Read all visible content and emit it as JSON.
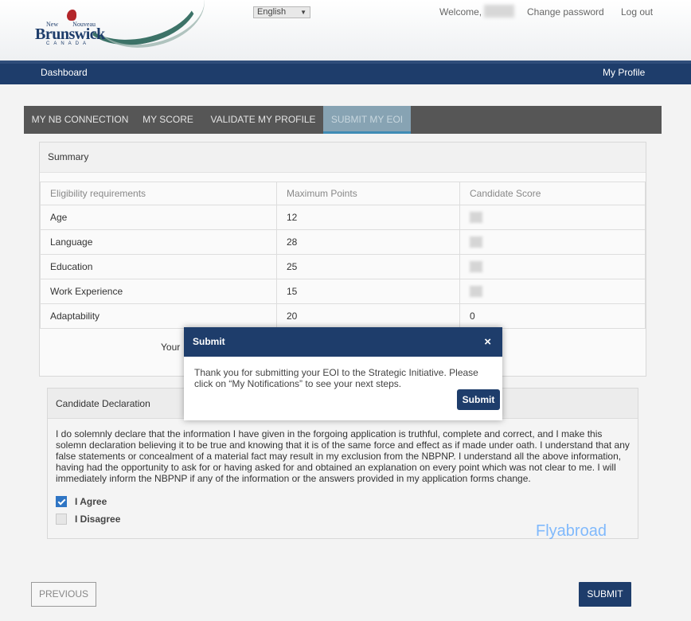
{
  "header": {
    "logo": {
      "top_left": "New",
      "top_right": "Nouveau",
      "brand": "Brunswick",
      "country": "CANADA"
    },
    "language": "English",
    "welcome": "Welcome,",
    "change_password": "Change password",
    "logout": "Log out"
  },
  "nav": {
    "dashboard": "Dashboard",
    "my_profile": "My Profile"
  },
  "tabs": [
    {
      "label": "MY NB CONNECTION",
      "active": false
    },
    {
      "label": "MY SCORE",
      "active": false
    },
    {
      "label": "VALIDATE MY PROFILE",
      "active": false
    },
    {
      "label": "SUBMIT MY EOI",
      "active": true
    }
  ],
  "summary": {
    "title": "Summary",
    "columns": [
      "Eligibility requirements",
      "Maximum Points",
      "Candidate Score"
    ],
    "rows": [
      {
        "requirement": "Age",
        "max": "12",
        "score": ""
      },
      {
        "requirement": "Language",
        "max": "28",
        "score": ""
      },
      {
        "requirement": "Education",
        "max": "25",
        "score": ""
      },
      {
        "requirement": "Work Experience",
        "max": "15",
        "score": ""
      },
      {
        "requirement": "Adaptability",
        "max": "20",
        "score": "0"
      }
    ],
    "total_prefix": "Your"
  },
  "declaration": {
    "title": "Candidate Declaration",
    "text": "I do solemnly declare that the information I have given in the forgoing application is truthful, complete and correct, and I make this solemn declaration believing it to be true and knowing that it is of the same force and effect as if made under oath. I understand that any false statements or concealment of a material fact may result in my exclusion from the NBPNP. I understand all the above information, having had the opportunity to ask for or having asked for and obtained an explanation on every point which was not clear to me. I will immediately inform the NBPNP if any of the information or the answers provided in my application forms change.",
    "agree_label": "I Agree",
    "agree_checked": true,
    "disagree_label": "I Disagree",
    "disagree_checked": false
  },
  "watermark": "Flyabroad",
  "buttons": {
    "previous": "PREVIOUS",
    "submit": "SUBMIT"
  },
  "modal": {
    "title": "Submit",
    "close": "×",
    "message": "Thank you for submitting your EOI to the Strategic Initiative. Please click on “My Notifications” to see your next steps.",
    "button": "Submit"
  },
  "colors": {
    "primary": "#1e3d6b",
    "tab_bar": "#565656",
    "active_tab": "#87a3b3",
    "checkbox": "#2f75c4"
  }
}
